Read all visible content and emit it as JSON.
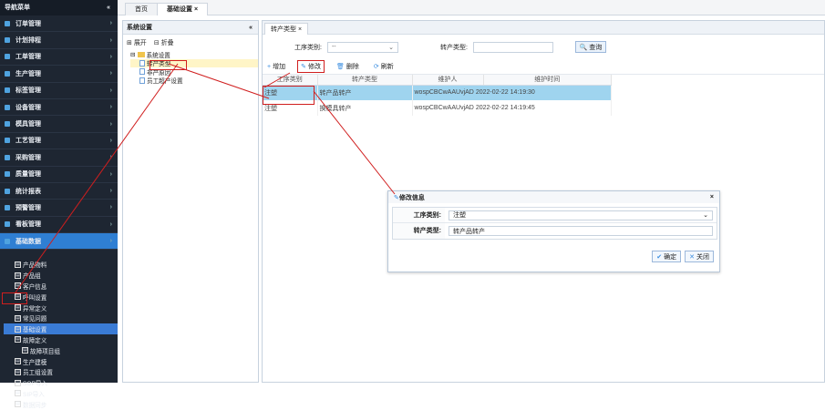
{
  "nav": {
    "title": "导航菜单",
    "collapse": "«",
    "items": [
      "订单管理",
      "计划排程",
      "工单管理",
      "生产管理",
      "标签管理",
      "设备管理",
      "模具管理",
      "工艺管理",
      "采购管理",
      "质量管理",
      "统计报表",
      "预警管理",
      "看板管理",
      "基础数据"
    ],
    "tree": [
      "产品物料",
      "产品组",
      "客户信息",
      "呼叫设置",
      "异常定义",
      "常见问题",
      "基础设置",
      "故障定义",
      "故障项目组",
      "生产建模",
      "员工组设置",
      "SOP导入",
      "SIP导入",
      "数据同步"
    ]
  },
  "tabs": {
    "home": "首页",
    "basic": "基础设置 ×"
  },
  "left": {
    "title": "系统设置",
    "collapse": "«",
    "expand": "展开",
    "fold": "折叠",
    "root": "系统设置",
    "items": [
      "转产类型",
      "非产原因",
      "员工超产设置"
    ]
  },
  "main": {
    "tab": "转产类型 ×",
    "search": {
      "label1": "工序类别:",
      "select1": "--",
      "label2": "转产类型:",
      "query": "查询"
    },
    "toolbar": {
      "add": "增加",
      "edit": "修改",
      "del": "删除",
      "refresh": "刷新"
    },
    "columns": [
      "工序类别",
      "转产类型",
      "维护人",
      "维护时间"
    ],
    "rows": [
      {
        "c1": "注塑",
        "c2": "转产品转产",
        "c3": "wospCBCwAAUvjAD",
        "c4": "2022-02-22 14:19:30"
      },
      {
        "c1": "注塑",
        "c2": "换模具转产",
        "c3": "wospCBCwAAUvjAD",
        "c4": "2022-02-22 14:19:45"
      }
    ]
  },
  "dialog": {
    "title": "修改信息",
    "close": "×",
    "label1": "工序类别:",
    "value1": "注塑",
    "label2": "转产类型:",
    "value2": "转产品转产",
    "ok": "确定",
    "cancel": "关闭"
  }
}
